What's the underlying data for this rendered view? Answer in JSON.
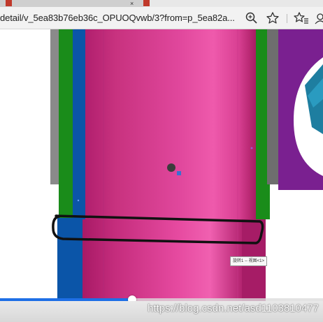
{
  "browser": {
    "tab_active_title": "",
    "tab_second_title": "",
    "url": "detail/v_5ea83b76eb36c_OPUOQvwb/3?from=p_5ea82a...",
    "icons": [
      "zoom-icon",
      "star-icon",
      "favorites-icon",
      "profile-icon"
    ]
  },
  "video": {
    "tooltip": "旋转1 -- 视图<1>",
    "watermark": "https://blog.csdn.net/asd1103810477",
    "progress_fraction": 0.41,
    "colors": {
      "pink": "#e0479c",
      "green": "#1a8c1a",
      "blue": "#0b55a8",
      "purple": "#7a2090",
      "teal": "#1e7ea0",
      "progress": "#1e6fe6"
    }
  }
}
